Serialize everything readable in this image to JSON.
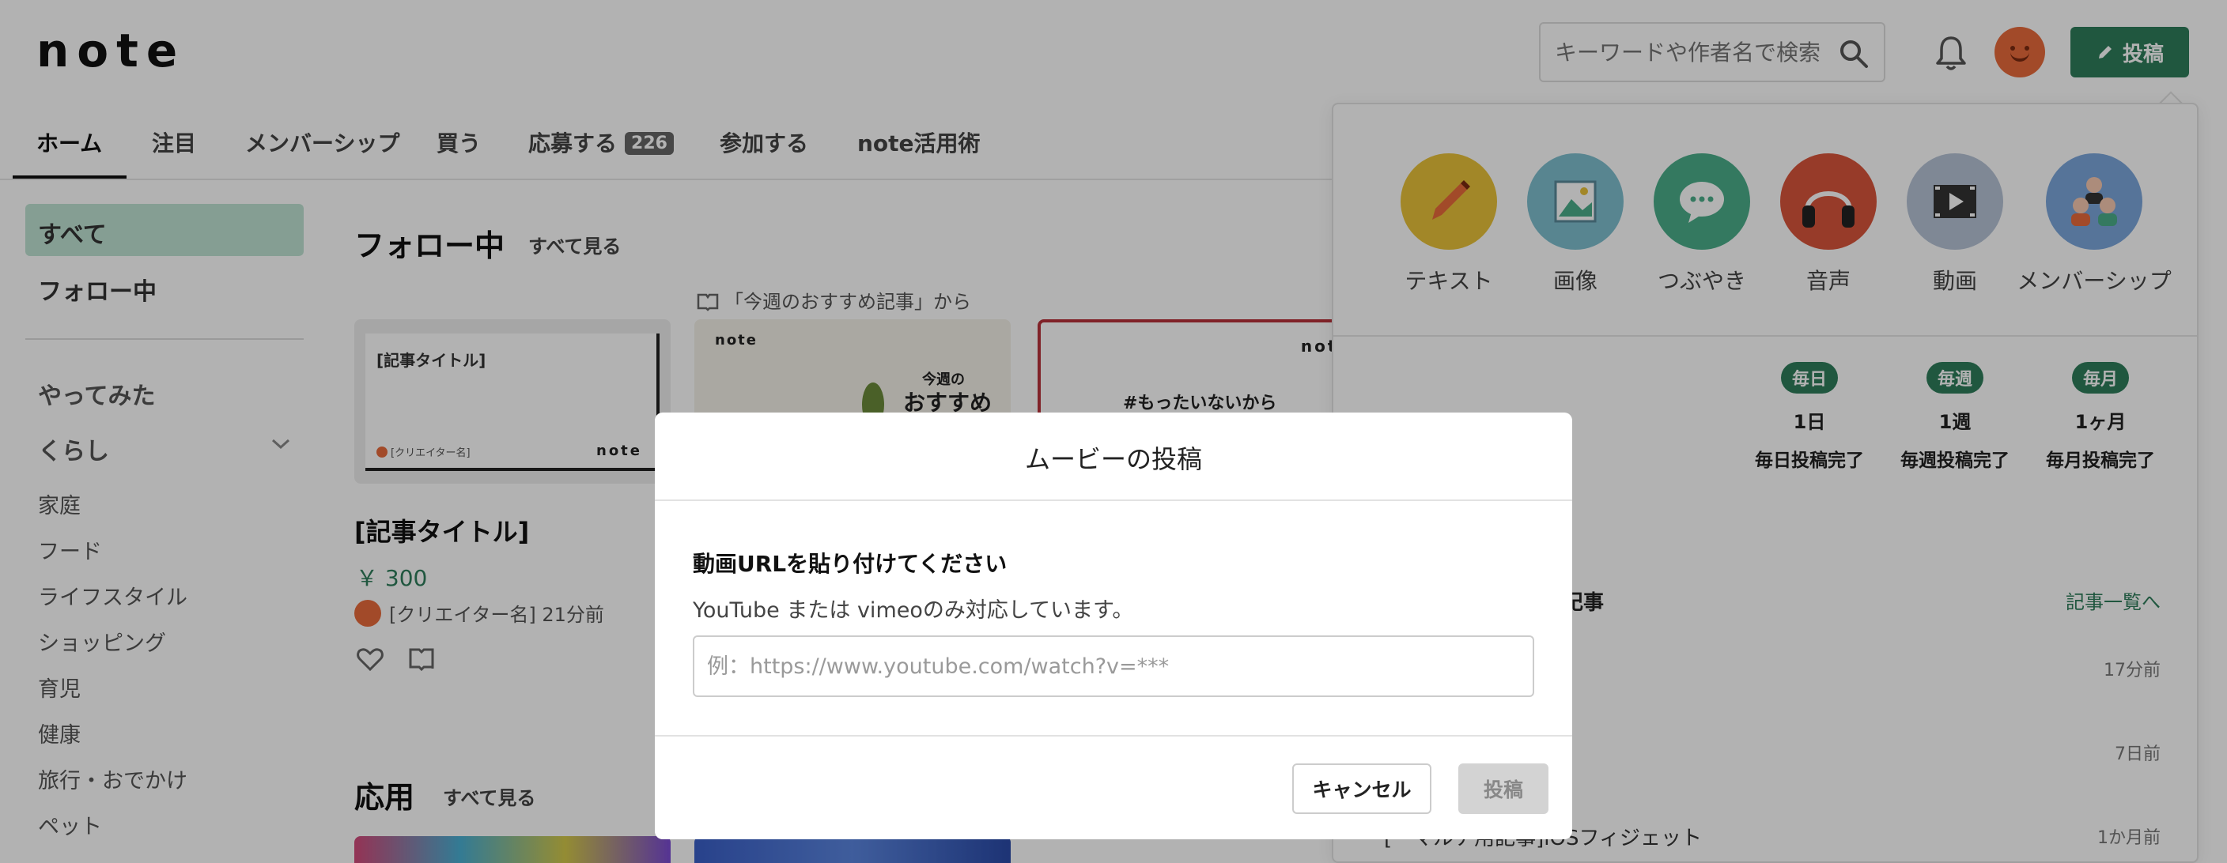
{
  "header": {
    "logo": "note",
    "search_placeholder": "キーワードや作者名で検索",
    "post_button": "投稿"
  },
  "nav": {
    "tabs": [
      {
        "label": "ホーム",
        "active": true
      },
      {
        "label": "注目"
      },
      {
        "label": "メンバーシップ"
      },
      {
        "label": "買う"
      },
      {
        "label": "応募する",
        "badge": "226"
      },
      {
        "label": "参加する"
      },
      {
        "label": "note活用術"
      }
    ]
  },
  "sidebar": {
    "items": [
      "すべて",
      "フォロー中",
      "やってみた",
      "くらし"
    ],
    "sub_items": [
      "家庭",
      "フード",
      "ライフスタイル",
      "ショッピング",
      "育児",
      "健康",
      "旅行・おでかけ",
      "ペット"
    ]
  },
  "main": {
    "following_title": "フォロー中",
    "following_see_all": "すべて見る",
    "from_label": "「今週のおすすめ記事」から",
    "card": {
      "thumb_title": "[記事タイトル]",
      "thumb_creator": "[クリエイター名]",
      "thumb_logo": "note",
      "title": "[記事タイトル]",
      "price": "￥ 300",
      "creator": "[クリエイター名] 21分前"
    },
    "card2": {
      "logo": "note",
      "line1": "今週の",
      "line2": "おすすめ"
    },
    "card3": {
      "logo": "note",
      "tag": "#もったいないから"
    },
    "applied_title": "応用",
    "applied_see_all": "すべて見る"
  },
  "popover": {
    "types": [
      {
        "label": "テキスト",
        "icon": "pencil-icon",
        "color": "#e8c23a"
      },
      {
        "label": "画像",
        "icon": "image-icon",
        "color": "#7fbfcf"
      },
      {
        "label": "つぶやき",
        "icon": "speech-bubble-icon",
        "color": "#4bae8a"
      },
      {
        "label": "音声",
        "icon": "headphones-icon",
        "color": "#d9553b"
      },
      {
        "label": "動画",
        "icon": "film-icon",
        "color": "#b7c3d6"
      },
      {
        "label": "メンバーシップ",
        "icon": "people-icon",
        "color": "#7ba7dc"
      }
    ],
    "streaks": [
      {
        "pill": "毎日",
        "count": "1日",
        "desc": "毎日投稿完了"
      },
      {
        "pill": "毎週",
        "count": "1週",
        "desc": "毎週投稿完了"
      },
      {
        "pill": "毎月",
        "count": "1ヶ月",
        "desc": "毎月投稿完了"
      }
    ],
    "articles_head": "記事",
    "articles_link": "記事一覧へ",
    "rows": [
      {
        "title": "",
        "time": "17分前"
      },
      {
        "title": "",
        "time": "7日前"
      },
      {
        "title": "[ーマルチ用記事]iOSフィジェット",
        "time": "1か月前"
      }
    ]
  },
  "modal": {
    "title": "ムービーの投稿",
    "heading": "動画URLを貼り付けてください",
    "note": "YouTube または vimeoのみ対応しています。",
    "url_placeholder": "例：https://www.youtube.com/watch?v=***",
    "cancel": "キャンセル",
    "submit": "投稿"
  },
  "colors": {
    "brand": "#2e7d5b",
    "accent_avatar": "#e86b3c"
  }
}
